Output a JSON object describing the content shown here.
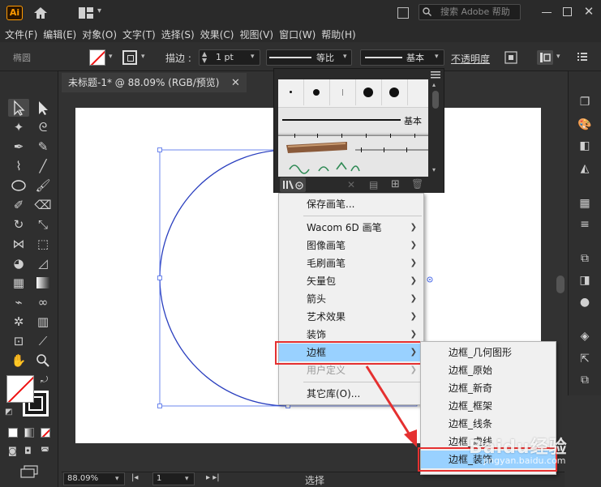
{
  "app": {
    "logo": "Ai",
    "search_placeholder": "搜索 Adobe 帮助"
  },
  "menubar": [
    "文件(F)",
    "编辑(E)",
    "对象(O)",
    "文字(T)",
    "选择(S)",
    "效果(C)",
    "视图(V)",
    "窗口(W)",
    "帮助(H)"
  ],
  "control": {
    "selection_name": "椭圆",
    "stroke_label": "描边",
    "stroke_weight": "1 pt",
    "profile_label": "等比",
    "brush_label": "基本",
    "opacity_label": "不透明度"
  },
  "document": {
    "tab_title": "未标题-1* @ 88.09% (RGB/预览)"
  },
  "status": {
    "zoom": "88.09%",
    "page": "1",
    "tool": "选择"
  },
  "brush_panel": {
    "basic_label": "基本"
  },
  "brush_menu": {
    "items": [
      {
        "label": "保存画笔...",
        "submenu": false,
        "disabled": false
      },
      {
        "label": "Wacom 6D 画笔",
        "submenu": true,
        "disabled": false
      },
      {
        "label": "图像画笔",
        "submenu": true,
        "disabled": false
      },
      {
        "label": "毛刷画笔",
        "submenu": true,
        "disabled": false
      },
      {
        "label": "矢量包",
        "submenu": true,
        "disabled": false
      },
      {
        "label": "箭头",
        "submenu": true,
        "disabled": false
      },
      {
        "label": "艺术效果",
        "submenu": true,
        "disabled": false
      },
      {
        "label": "装饰",
        "submenu": true,
        "disabled": false
      },
      {
        "label": "边框",
        "submenu": true,
        "disabled": false
      },
      {
        "label": "用户定义",
        "submenu": true,
        "disabled": true
      },
      {
        "label": "其它库(O)...",
        "submenu": false,
        "disabled": false
      }
    ]
  },
  "border_submenu": {
    "items": [
      "边框_几何图形",
      "边框_原始",
      "边框_新奇",
      "边框_框架",
      "边框_线条",
      "边框_虚线",
      "边框_装饰"
    ]
  },
  "watermark": {
    "text": "Baidu经验",
    "sub": "jingyan.baidu.com"
  },
  "colors": {
    "highlight": "#99d1ff",
    "annotation_red": "#e53030",
    "path_blue": "#2a3fbf"
  }
}
